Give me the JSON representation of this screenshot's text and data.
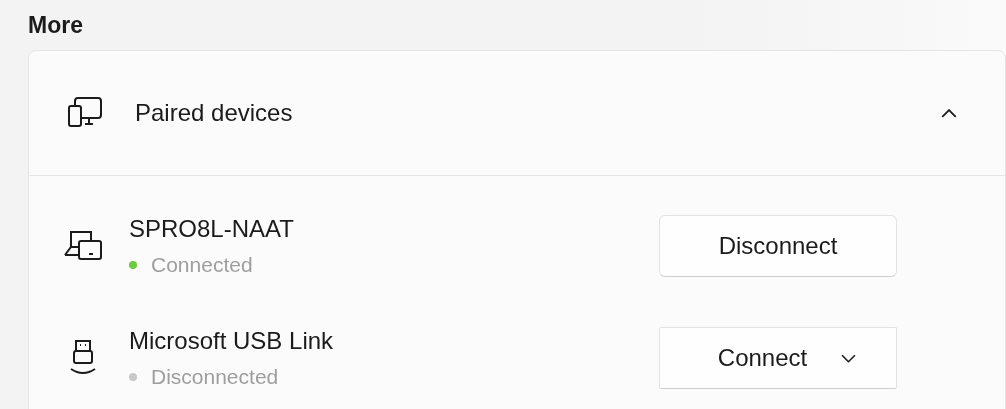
{
  "section_title": "More",
  "group": {
    "title": "Paired devices",
    "expanded": true,
    "devices": [
      {
        "kind": "laptop",
        "name": "SPRO8L-NAAT",
        "status": "Connected",
        "connected": true,
        "button": {
          "label": "Disconnect",
          "has_dropdown": false
        }
      },
      {
        "kind": "usb",
        "name": "Microsoft USB Link",
        "status": "Disconnected",
        "connected": false,
        "button": {
          "label": "Connect",
          "has_dropdown": true
        }
      }
    ]
  }
}
